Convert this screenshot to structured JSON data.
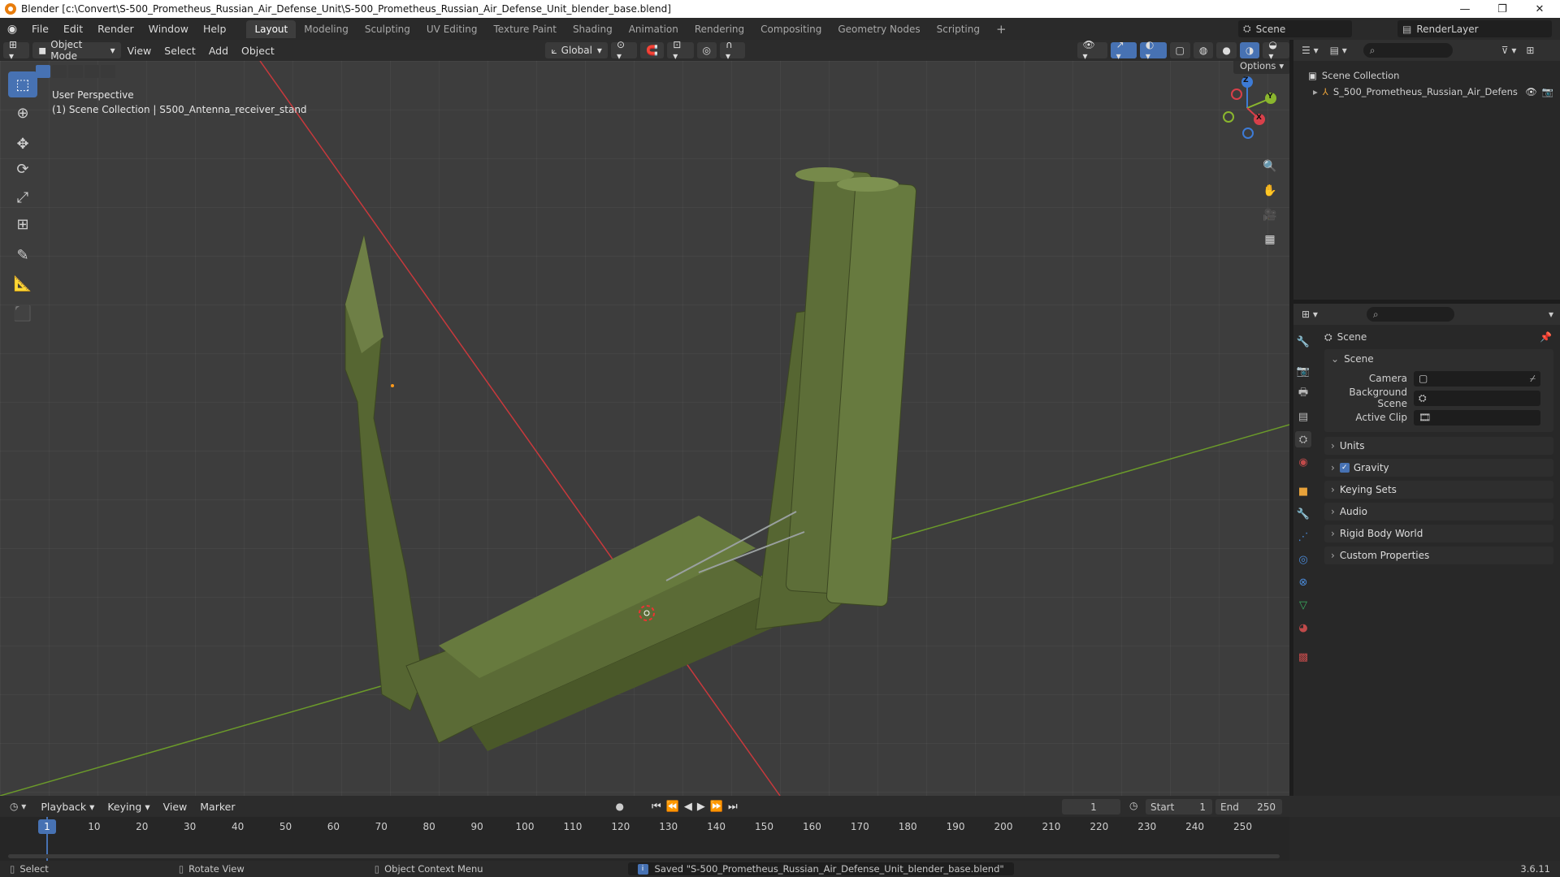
{
  "window": {
    "title": "Blender [c:\\Convert\\S-500_Prometheus_Russian_Air_Defense_Unit\\S-500_Prometheus_Russian_Air_Defense_Unit_blender_base.blend]",
    "minimize": "—",
    "maximize": "❐",
    "close": "✕"
  },
  "menu": [
    "File",
    "Edit",
    "Render",
    "Window",
    "Help"
  ],
  "workspaces": [
    "Layout",
    "Modeling",
    "Sculpting",
    "UV Editing",
    "Texture Paint",
    "Shading",
    "Animation",
    "Rendering",
    "Compositing",
    "Geometry Nodes",
    "Scripting"
  ],
  "workspace_add": "+",
  "scene_selector": {
    "scene": "Scene",
    "view_layer": "RenderLayer"
  },
  "viewport_header": {
    "mode": "Object Mode",
    "menus": [
      "View",
      "Select",
      "Add",
      "Object"
    ],
    "transform_orientation": "Global",
    "options": "Options"
  },
  "viewport": {
    "perspective": "User Perspective",
    "collection_info": "(1) Scene Collection | S500_Antenna_receiver_stand",
    "gizmo": {
      "x": "X",
      "y": "Y",
      "z": "Z"
    }
  },
  "outliner": {
    "root": "Scene Collection",
    "items": [
      {
        "name": "S_500_Prometheus_Russian_Air_Defens"
      }
    ]
  },
  "properties": {
    "header": "Scene",
    "section_scene": "Scene",
    "camera_label": "Camera",
    "background_scene_label": "Background Scene",
    "active_clip_label": "Active Clip",
    "panels": [
      "Units",
      "Gravity",
      "Keying Sets",
      "Audio",
      "Rigid Body World",
      "Custom Properties"
    ],
    "gravity_checked": true
  },
  "timeline": {
    "menus": [
      "Playback",
      "Keying",
      "View",
      "Marker"
    ],
    "current_frame": "1",
    "start_label": "Start",
    "start": "1",
    "end_label": "End",
    "end": "250",
    "ticks": [
      "1",
      "10",
      "20",
      "30",
      "40",
      "50",
      "60",
      "70",
      "80",
      "90",
      "100",
      "110",
      "120",
      "130",
      "140",
      "150",
      "160",
      "170",
      "180",
      "190",
      "200",
      "210",
      "220",
      "230",
      "240",
      "250"
    ]
  },
  "statusbar": {
    "select": "Select",
    "rotate": "Rotate View",
    "context": "Object Context Menu",
    "message": "Saved \"S-500_Prometheus_Russian_Air_Defense_Unit_blender_base.blend\"",
    "version": "3.6.11"
  },
  "colors": {
    "accent": "#4772b3",
    "model": "#5a6b35",
    "x_axis": "#c8393c",
    "y_axis": "#6b9a2a"
  }
}
